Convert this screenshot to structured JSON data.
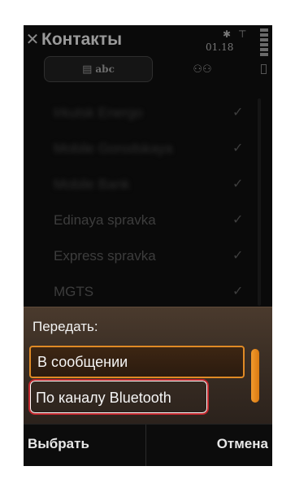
{
  "header": {
    "title": "Контакты",
    "clock": "01.18",
    "close_icon": "close-icon",
    "bluetooth_icon": "bluetooth-icon",
    "network_icon": "network-icon"
  },
  "tabs": [
    {
      "label": "abc",
      "icon": "contact-list-icon",
      "active": true
    },
    {
      "label": "",
      "icon": "groups-icon",
      "active": false
    }
  ],
  "contacts": [
    {
      "name": "Irkutsk Energo",
      "blurred": true
    },
    {
      "name": "Mobile Gorodskaya",
      "blurred": true
    },
    {
      "name": "Mobile Bank",
      "blurred": true
    },
    {
      "name": "Edinaya spravka",
      "blurred": false
    },
    {
      "name": "Express spravka",
      "blurred": false
    },
    {
      "name": "MGTS",
      "blurred": false
    }
  ],
  "popup": {
    "title": "Передать:",
    "options": [
      {
        "label": "В сообщении",
        "selected": true
      },
      {
        "label": "По каналу Bluetooth",
        "selected": false,
        "highlighted": true
      }
    ]
  },
  "softkeys": {
    "left": "Выбрать",
    "right": "Отмена"
  },
  "colors": {
    "accent": "#e08a25",
    "highlight_ring": "#c1272d",
    "popup_bg": "#3c2f25"
  }
}
